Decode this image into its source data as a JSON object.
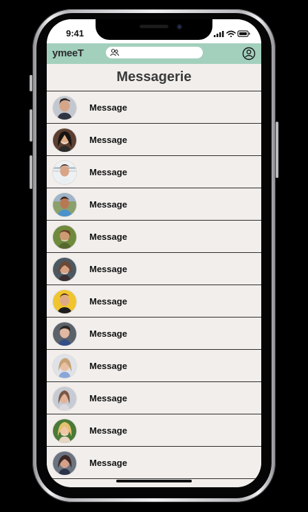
{
  "status_bar": {
    "time": "9:41"
  },
  "header": {
    "logo": "ymeeT",
    "search": {
      "value": "",
      "placeholder": "",
      "icon": "people-search-icon"
    },
    "profile_icon": "user-circle-icon",
    "background_color": "#a2d0bd"
  },
  "page": {
    "title": "Messagerie"
  },
  "messages": [
    {
      "label": "Message",
      "avatar": "avatar-man-1"
    },
    {
      "label": "Message",
      "avatar": "avatar-woman-1"
    },
    {
      "label": "Message",
      "avatar": "avatar-man-2"
    },
    {
      "label": "Message",
      "avatar": "avatar-man-3"
    },
    {
      "label": "Message",
      "avatar": "avatar-man-4"
    },
    {
      "label": "Message",
      "avatar": "avatar-woman-2"
    },
    {
      "label": "Message",
      "avatar": "avatar-man-5"
    },
    {
      "label": "Message",
      "avatar": "avatar-man-6"
    },
    {
      "label": "Message",
      "avatar": "avatar-woman-3"
    },
    {
      "label": "Message",
      "avatar": "avatar-woman-4"
    },
    {
      "label": "Message",
      "avatar": "avatar-woman-5"
    },
    {
      "label": "Message",
      "avatar": "avatar-woman-6"
    }
  ]
}
